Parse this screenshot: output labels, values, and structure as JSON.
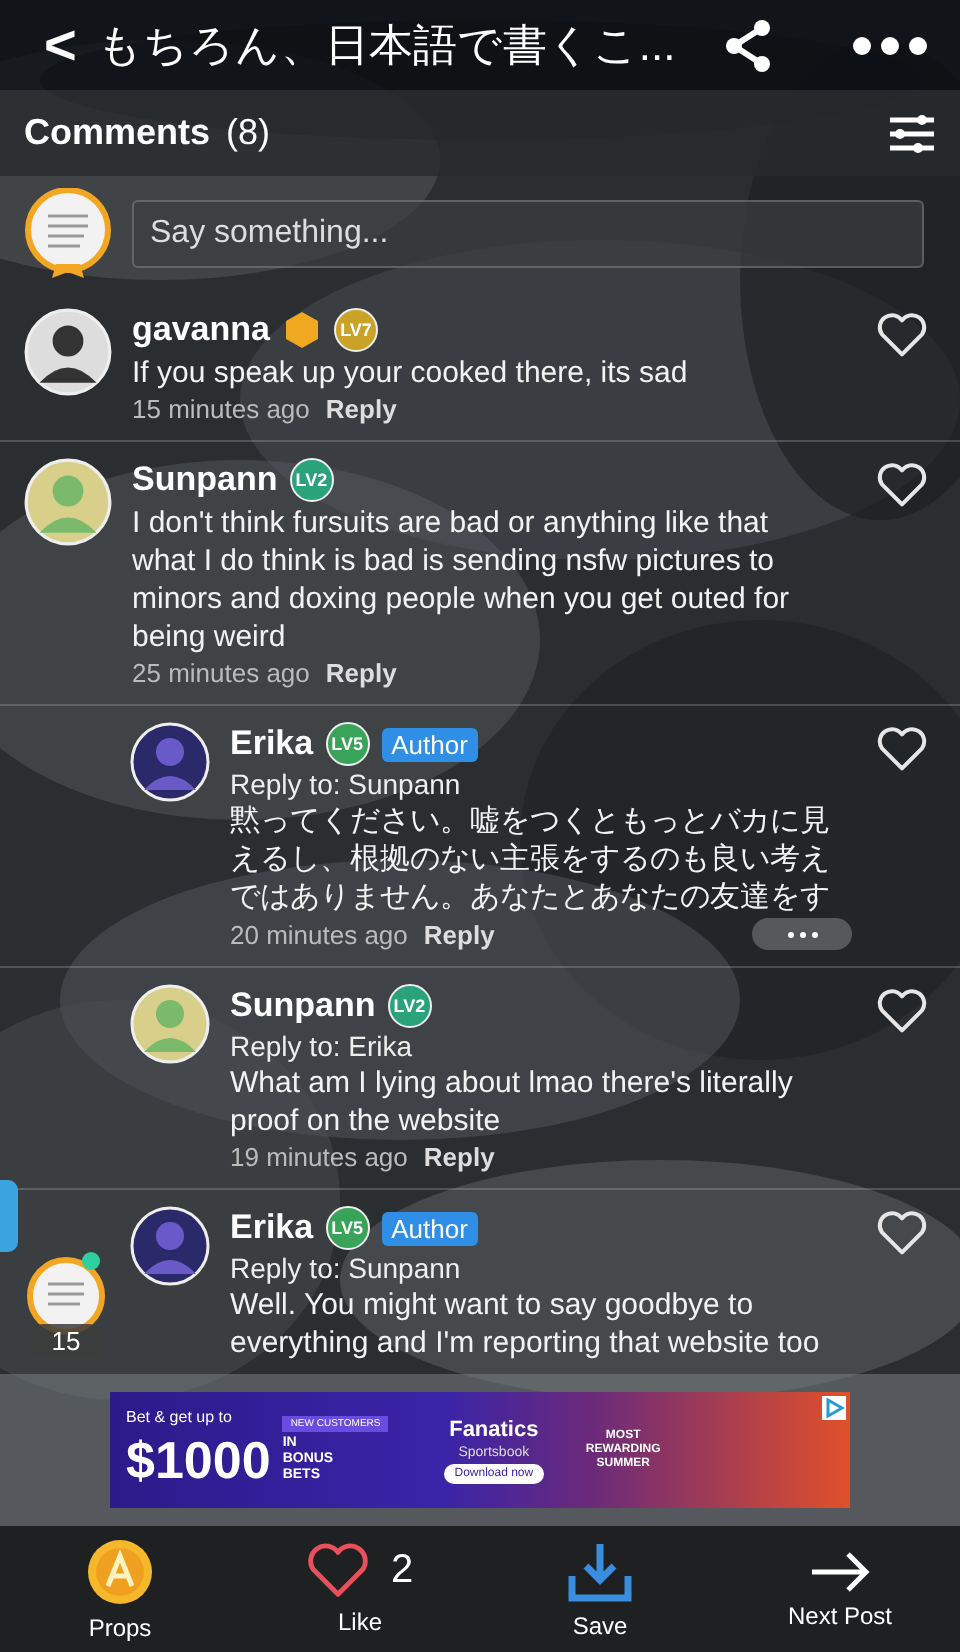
{
  "header": {
    "back": "<",
    "title": "もちろん、日本語で書くこ..."
  },
  "comments_bar": {
    "label": "Comments",
    "count": "(8)"
  },
  "composer": {
    "placeholder": "Say something..."
  },
  "comments": [
    {
      "kind": "top",
      "name": "gavanna",
      "badges": [
        {
          "kind": "hex",
          "color": "#f0a820"
        },
        {
          "kind": "level",
          "label": "LV7",
          "color": "#c9a227"
        }
      ],
      "text": "If you speak up your cooked there, its sad",
      "time": "15 minutes ago",
      "reply": "Reply",
      "liked": false
    },
    {
      "kind": "top",
      "name": "Sunpann",
      "badges": [
        {
          "kind": "level",
          "label": "LV2",
          "color": "#2aa37a"
        }
      ],
      "text": "I don't think fursuits are bad or anything like that what I do think is bad is sending nsfw pictures to minors and doxing people when you get outed for being weird",
      "time": "25 minutes ago",
      "reply": "Reply",
      "liked": false
    },
    {
      "kind": "reply",
      "name": "Erika",
      "badges": [
        {
          "kind": "level",
          "label": "LV5",
          "color": "#3aa35a"
        }
      ],
      "author": "Author",
      "reply_to": "Reply to: Sunpann",
      "text": "黙ってください。嘘をつくともっとバカに見えるし、根拠のない主張をするのも良い考えではありません。あなたとあなたの友達をす",
      "time": "20 minutes ago",
      "reply": "Reply",
      "more": true,
      "liked": false
    },
    {
      "kind": "reply",
      "name": "Sunpann",
      "badges": [
        {
          "kind": "level",
          "label": "LV2",
          "color": "#2aa37a"
        }
      ],
      "reply_to": "Reply to: Erika",
      "text": "What am I lying about lmao there's literally proof on the website",
      "time": "19 minutes ago",
      "reply": "Reply",
      "liked": false
    },
    {
      "kind": "reply",
      "name": "Erika",
      "badges": [
        {
          "kind": "level",
          "label": "LV5",
          "color": "#3aa35a"
        }
      ],
      "author": "Author",
      "reply_to": "Reply to: Sunpann",
      "text": "Well. You might want to say goodbye to everything and I'm reporting that website too",
      "liked": false
    }
  ],
  "floating": {
    "count": "15"
  },
  "ad": {
    "tag": "NEW CUSTOMERS",
    "lead": "Bet & get up to",
    "amount": "$1000",
    "bonus": "IN BONUS BETS",
    "brand": "Fanatics",
    "sub": "Sportsbook",
    "cta": "Download now",
    "promo": "MOST REWARDING SUMMER"
  },
  "bottom_bar": [
    {
      "kind": "props",
      "label": "Props"
    },
    {
      "kind": "like",
      "label": "Like",
      "count": "2"
    },
    {
      "kind": "save",
      "label": "Save"
    },
    {
      "kind": "next",
      "label": "Next Post"
    }
  ]
}
